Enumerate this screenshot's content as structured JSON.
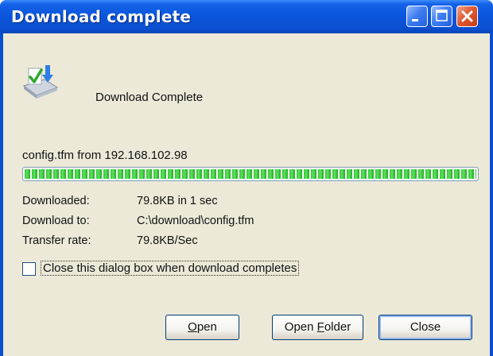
{
  "window": {
    "title": "Download complete"
  },
  "titlebar_buttons": {
    "minimize_icon": "minimize-icon",
    "maximize_icon": "maximize-icon",
    "close_icon": "close-icon"
  },
  "dialog": {
    "icon": "download-complete-icon",
    "headline": "Download Complete",
    "source": "config.tfm from 192.168.102.98",
    "progress_fraction": 1.0,
    "details": [
      {
        "label": "Downloaded:",
        "value": "79.8KB in 1 sec"
      },
      {
        "label": "Download to:",
        "value": "C:\\download\\config.tfm"
      },
      {
        "label": "Transfer rate:",
        "value": "79.8KB/Sec"
      }
    ],
    "close_when_done": {
      "label": "Close this dialog box when download completes",
      "checked": false
    }
  },
  "buttons": {
    "open": {
      "mnemonic": "O",
      "rest": "pen"
    },
    "open_folder": {
      "prefix": "Open ",
      "mnemonic": "F",
      "rest": "older"
    },
    "close": "Close"
  },
  "colors": {
    "titlebar": "#0a4fd0",
    "face": "#ece9d8",
    "progress": "#32c732"
  }
}
